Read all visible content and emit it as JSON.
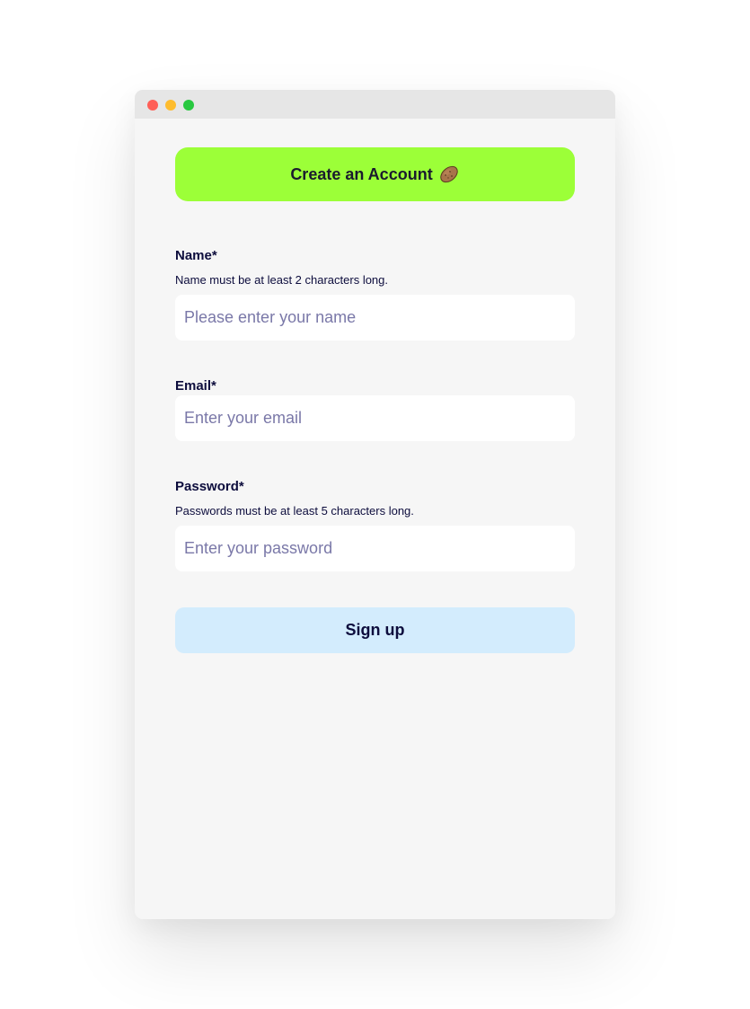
{
  "window": {
    "controls": [
      {
        "name": "close",
        "color": "#ff5f57"
      },
      {
        "name": "minimize",
        "color": "#febc2e"
      },
      {
        "name": "maximize",
        "color": "#28c840"
      }
    ]
  },
  "form": {
    "title": "Create an Account",
    "title_icon": "potato-icon",
    "title_bg": "#9cff38",
    "name": {
      "label": "Name*",
      "hint": "Name must be at least 2 characters long.",
      "placeholder": "Please enter your name",
      "value": ""
    },
    "email": {
      "label": "Email*",
      "placeholder": "Enter your email",
      "value": ""
    },
    "password": {
      "label": "Password*",
      "hint": "Passwords must be at least 5 characters long.",
      "placeholder": "Enter your password",
      "value": ""
    },
    "submit_label": "Sign up",
    "submit_bg": "#d3ecfd"
  }
}
